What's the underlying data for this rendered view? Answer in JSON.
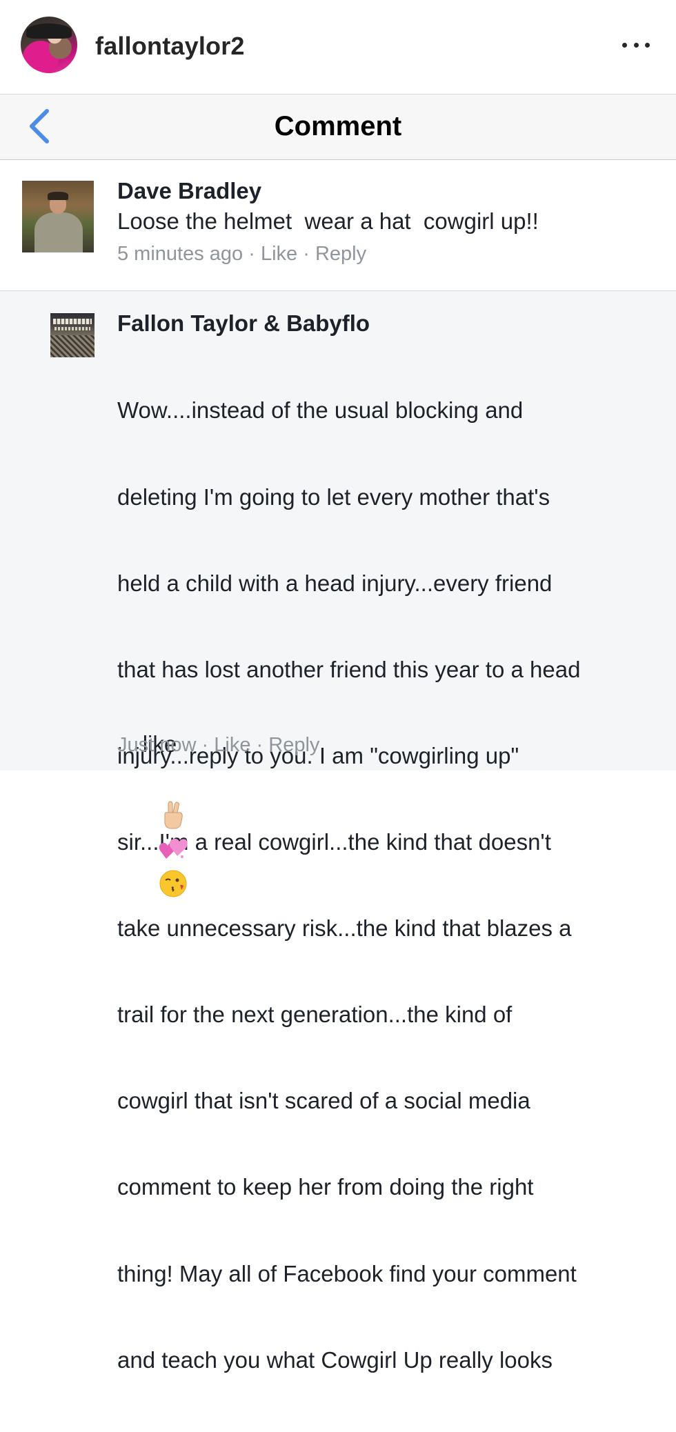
{
  "header": {
    "username": "fallontaylor2",
    "more_icon": "more-horizontal-icon"
  },
  "nav": {
    "back_icon": "chevron-left-icon",
    "title": "Comment",
    "accent": "#4a8ce6"
  },
  "comment": {
    "author": "Dave Bradley",
    "text": "Loose the helmet  wear a hat  cowgirl up!!",
    "time": "5 minutes ago",
    "like": "Like",
    "reply": "Reply",
    "separator": "·"
  },
  "reply": {
    "author": "Fallon Taylor & Babyflo",
    "lines": [
      "Wow....instead of the usual blocking and",
      "deleting I'm going to let every mother that's",
      "held a child with a head injury...every friend",
      "that has lost another friend this year to a head",
      "injury...reply to you. I am \"cowgirling up\"",
      "sir...I'm a real cowgirl...the kind that doesn't",
      "take unnecessary risk...the kind that blazes a",
      "trail for the next generation...the kind of",
      "cowgirl that isn't scared of a social media",
      "comment to keep her from doing the right",
      "thing! May all of Facebook find your comment",
      "and teach you what Cowgirl Up really looks"
    ],
    "last_word": "like",
    "emojis": [
      "victory-hand-icon",
      "two-hearts-icon",
      "kissing-face-icon"
    ],
    "time": "Just now",
    "like": "Like",
    "reply": "Reply",
    "separator": "·"
  },
  "colors": {
    "text": "#1d2129",
    "meta": "#90949c",
    "nav_bg": "#f7f7f8",
    "reply_bg": "#f5f6f7"
  }
}
